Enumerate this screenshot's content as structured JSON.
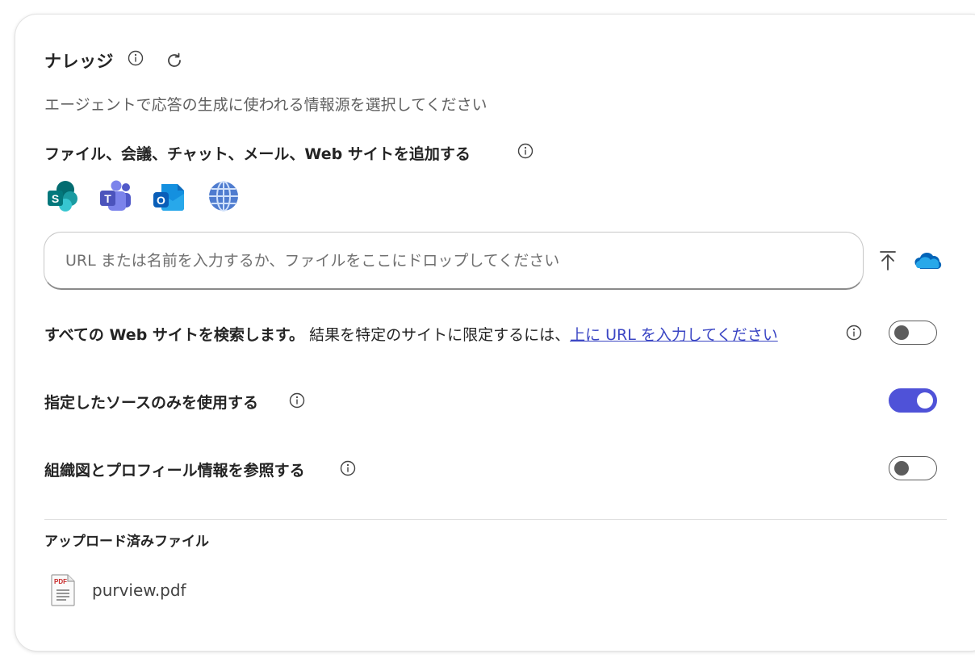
{
  "header": {
    "title": "ナレッジ",
    "subtitle": "エージェントで応答の生成に使われる情報源を選択してください"
  },
  "sources": {
    "title": "ファイル、会議、チャット、メール、Web サイトを追加する",
    "icons": [
      "sharepoint-icon",
      "teams-icon",
      "outlook-icon",
      "web-globe-icon"
    ]
  },
  "input": {
    "placeholder": "URL または名前を入力するか、ファイルをここにドロップしてください"
  },
  "web_search": {
    "bold_label": "すべての Web サイトを検索します。",
    "description": "結果を特定のサイトに限定するには、",
    "link_text": "上に URL を入力してください",
    "enabled": false
  },
  "only_specified": {
    "label": "指定したソースのみを使用する",
    "enabled": true
  },
  "org_chart": {
    "label": "組織図とプロフィール情報を参照する",
    "enabled": false
  },
  "uploaded": {
    "title": "アップロード済みファイル",
    "files": [
      {
        "name": "purview.pdf",
        "type_badge": "PDF"
      }
    ]
  },
  "colors": {
    "accent": "#4f52d8",
    "link": "#3b46c4",
    "text": "#242424",
    "muted": "#616161"
  }
}
